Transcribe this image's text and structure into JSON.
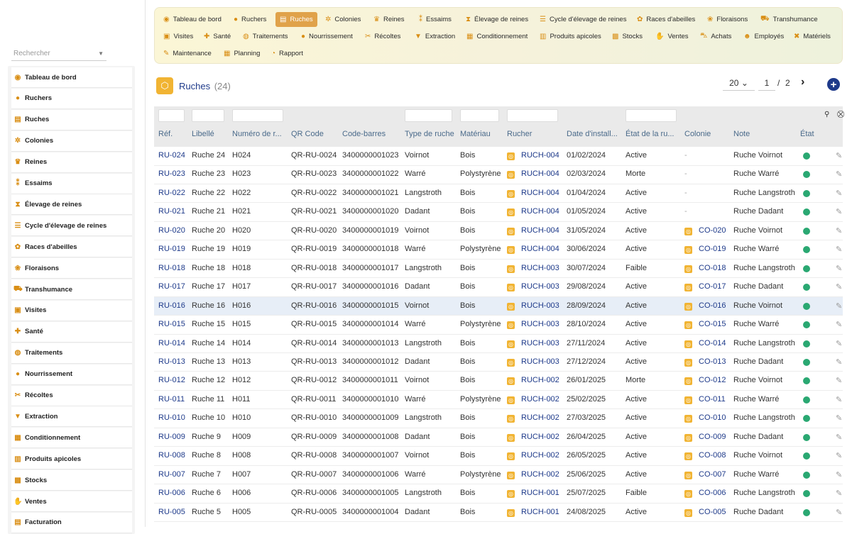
{
  "sidebar": {
    "search_placeholder": "Rechercher",
    "items": [
      {
        "label": "Tableau de bord",
        "icon": "dashboard-icon"
      },
      {
        "label": "Ruchers",
        "icon": "map-pin-icon"
      },
      {
        "label": "Ruches",
        "icon": "hive-icon"
      },
      {
        "label": "Colonies",
        "icon": "bee-icon"
      },
      {
        "label": "Reines",
        "icon": "crown-icon"
      },
      {
        "label": "Essaims",
        "icon": "swarm-icon"
      },
      {
        "label": "Élevage de reines",
        "icon": "hourglass-icon"
      },
      {
        "label": "Cycle d'élevage de reines",
        "icon": "cycle-icon"
      },
      {
        "label": "Races d'abeilles",
        "icon": "race-icon"
      },
      {
        "label": "Floraisons",
        "icon": "flower-icon"
      },
      {
        "label": "Transhumance",
        "icon": "truck-icon"
      },
      {
        "label": "Visites",
        "icon": "clipboard-icon"
      },
      {
        "label": "Santé",
        "icon": "health-icon"
      },
      {
        "label": "Traitements",
        "icon": "pills-icon"
      },
      {
        "label": "Nourrissement",
        "icon": "drop-icon"
      },
      {
        "label": "Récoltes",
        "icon": "harvest-icon"
      },
      {
        "label": "Extraction",
        "icon": "funnel-icon"
      },
      {
        "label": "Conditionnement",
        "icon": "box-icon"
      },
      {
        "label": "Produits apicoles",
        "icon": "product-icon"
      },
      {
        "label": "Stocks",
        "icon": "stock-icon"
      },
      {
        "label": "Ventes",
        "icon": "sales-icon"
      },
      {
        "label": "Facturation",
        "icon": "invoice-icon"
      }
    ]
  },
  "topnav": {
    "items": [
      {
        "label": "Tableau de bord",
        "glyph": "◉",
        "active": false
      },
      {
        "label": "Ruchers",
        "glyph": "●",
        "active": false
      },
      {
        "label": "Ruches",
        "glyph": "▤",
        "active": true
      },
      {
        "label": "Colonies",
        "glyph": "✲",
        "active": false
      },
      {
        "label": "Reines",
        "glyph": "♛",
        "active": false
      },
      {
        "label": "Essaims",
        "glyph": "⁑",
        "active": false
      },
      {
        "label": "Élevage de reines",
        "glyph": "⧗",
        "active": false
      },
      {
        "label": "Cycle d'élevage de reines",
        "glyph": "☰",
        "active": false
      },
      {
        "label": "Races d'abeilles",
        "glyph": "✿",
        "active": false
      },
      {
        "label": "Floraisons",
        "glyph": "❀",
        "active": false
      },
      {
        "label": "Transhumance",
        "glyph": "⛟",
        "active": false
      },
      {
        "label": "Visites",
        "glyph": "▣",
        "active": false
      },
      {
        "label": "Santé",
        "glyph": "✚",
        "active": false
      },
      {
        "label": "Traitements",
        "glyph": "◍",
        "active": false
      },
      {
        "label": "Nourrissement",
        "glyph": "●",
        "active": false
      },
      {
        "label": "Récoltes",
        "glyph": "✂",
        "active": false
      },
      {
        "label": "Extraction",
        "glyph": "▼",
        "active": false
      },
      {
        "label": "Conditionnement",
        "glyph": "▦",
        "active": false
      },
      {
        "label": "Produits apicoles",
        "glyph": "▥",
        "active": false
      },
      {
        "label": "Stocks",
        "glyph": "▩",
        "active": false
      },
      {
        "label": "Ventes",
        "glyph": "✋",
        "active": false
      },
      {
        "label": "Achats",
        "glyph": "⛍",
        "active": false
      },
      {
        "label": "Employés",
        "glyph": "☻",
        "active": false
      },
      {
        "label": "Matériels",
        "glyph": "✖",
        "active": false
      },
      {
        "label": "Maintenance",
        "glyph": "✎",
        "active": false
      },
      {
        "label": "Planning",
        "glyph": "▦",
        "active": false
      },
      {
        "label": "Rapport",
        "glyph": "◔",
        "active": false
      }
    ]
  },
  "header": {
    "title": "Ruches",
    "count": "(24)",
    "page_size": "20",
    "page_current": "1",
    "page_sep": "/",
    "page_total": "2"
  },
  "table": {
    "columns": [
      "Réf.",
      "Libellé",
      "Numéro de r...",
      "QR Code",
      "Code-barres",
      "Type de ruche",
      "Matériau",
      "Rucher",
      "Date d'install...",
      "État de la ru...",
      "Colonie",
      "Note",
      "État"
    ],
    "rows": [
      {
        "ref": "RU-024",
        "libelle": "Ruche 24",
        "numero": "H024",
        "qr": "QR-RU-0024",
        "barcode": "3400000001023",
        "type": "Voirnot",
        "materiau": "Bois",
        "rucher": "RUCH-004",
        "date": "01/02/2024",
        "etat": "Active",
        "colonie": "-",
        "note": "Ruche Voirnot"
      },
      {
        "ref": "RU-023",
        "libelle": "Ruche 23",
        "numero": "H023",
        "qr": "QR-RU-0023",
        "barcode": "3400000001022",
        "type": "Warré",
        "materiau": "Polystyrène",
        "rucher": "RUCH-004",
        "date": "02/03/2024",
        "etat": "Morte",
        "colonie": "-",
        "note": "Ruche Warré"
      },
      {
        "ref": "RU-022",
        "libelle": "Ruche 22",
        "numero": "H022",
        "qr": "QR-RU-0022",
        "barcode": "3400000001021",
        "type": "Langstroth",
        "materiau": "Bois",
        "rucher": "RUCH-004",
        "date": "01/04/2024",
        "etat": "Active",
        "colonie": "-",
        "note": "Ruche Langstroth"
      },
      {
        "ref": "RU-021",
        "libelle": "Ruche 21",
        "numero": "H021",
        "qr": "QR-RU-0021",
        "barcode": "3400000001020",
        "type": "Dadant",
        "materiau": "Bois",
        "rucher": "RUCH-004",
        "date": "01/05/2024",
        "etat": "Active",
        "colonie": "-",
        "note": "Ruche Dadant"
      },
      {
        "ref": "RU-020",
        "libelle": "Ruche 20",
        "numero": "H020",
        "qr": "QR-RU-0020",
        "barcode": "3400000001019",
        "type": "Voirnot",
        "materiau": "Bois",
        "rucher": "RUCH-004",
        "date": "31/05/2024",
        "etat": "Active",
        "colonie": "CO-020",
        "note": "Ruche Voirnot"
      },
      {
        "ref": "RU-019",
        "libelle": "Ruche 19",
        "numero": "H019",
        "qr": "QR-RU-0019",
        "barcode": "3400000001018",
        "type": "Warré",
        "materiau": "Polystyrène",
        "rucher": "RUCH-004",
        "date": "30/06/2024",
        "etat": "Active",
        "colonie": "CO-019",
        "note": "Ruche Warré"
      },
      {
        "ref": "RU-018",
        "libelle": "Ruche 18",
        "numero": "H018",
        "qr": "QR-RU-0018",
        "barcode": "3400000001017",
        "type": "Langstroth",
        "materiau": "Bois",
        "rucher": "RUCH-003",
        "date": "30/07/2024",
        "etat": "Faible",
        "colonie": "CO-018",
        "note": "Ruche Langstroth"
      },
      {
        "ref": "RU-017",
        "libelle": "Ruche 17",
        "numero": "H017",
        "qr": "QR-RU-0017",
        "barcode": "3400000001016",
        "type": "Dadant",
        "materiau": "Bois",
        "rucher": "RUCH-003",
        "date": "29/08/2024",
        "etat": "Active",
        "colonie": "CO-017",
        "note": "Ruche Dadant"
      },
      {
        "ref": "RU-016",
        "libelle": "Ruche 16",
        "numero": "H016",
        "qr": "QR-RU-0016",
        "barcode": "3400000001015",
        "type": "Voirnot",
        "materiau": "Bois",
        "rucher": "RUCH-003",
        "date": "28/09/2024",
        "etat": "Active",
        "colonie": "CO-016",
        "note": "Ruche Voirnot",
        "hl": true
      },
      {
        "ref": "RU-015",
        "libelle": "Ruche 15",
        "numero": "H015",
        "qr": "QR-RU-0015",
        "barcode": "3400000001014",
        "type": "Warré",
        "materiau": "Polystyrène",
        "rucher": "RUCH-003",
        "date": "28/10/2024",
        "etat": "Active",
        "colonie": "CO-015",
        "note": "Ruche Warré"
      },
      {
        "ref": "RU-014",
        "libelle": "Ruche 14",
        "numero": "H014",
        "qr": "QR-RU-0014",
        "barcode": "3400000001013",
        "type": "Langstroth",
        "materiau": "Bois",
        "rucher": "RUCH-003",
        "date": "27/11/2024",
        "etat": "Active",
        "colonie": "CO-014",
        "note": "Ruche Langstroth"
      },
      {
        "ref": "RU-013",
        "libelle": "Ruche 13",
        "numero": "H013",
        "qr": "QR-RU-0013",
        "barcode": "3400000001012",
        "type": "Dadant",
        "materiau": "Bois",
        "rucher": "RUCH-003",
        "date": "27/12/2024",
        "etat": "Active",
        "colonie": "CO-013",
        "note": "Ruche Dadant"
      },
      {
        "ref": "RU-012",
        "libelle": "Ruche 12",
        "numero": "H012",
        "qr": "QR-RU-0012",
        "barcode": "3400000001011",
        "type": "Voirnot",
        "materiau": "Bois",
        "rucher": "RUCH-002",
        "date": "26/01/2025",
        "etat": "Morte",
        "colonie": "CO-012",
        "note": "Ruche Voirnot"
      },
      {
        "ref": "RU-011",
        "libelle": "Ruche 11",
        "numero": "H011",
        "qr": "QR-RU-0011",
        "barcode": "3400000001010",
        "type": "Warré",
        "materiau": "Polystyrène",
        "rucher": "RUCH-002",
        "date": "25/02/2025",
        "etat": "Active",
        "colonie": "CO-011",
        "note": "Ruche Warré"
      },
      {
        "ref": "RU-010",
        "libelle": "Ruche 10",
        "numero": "H010",
        "qr": "QR-RU-0010",
        "barcode": "3400000001009",
        "type": "Langstroth",
        "materiau": "Bois",
        "rucher": "RUCH-002",
        "date": "27/03/2025",
        "etat": "Active",
        "colonie": "CO-010",
        "note": "Ruche Langstroth"
      },
      {
        "ref": "RU-009",
        "libelle": "Ruche 9",
        "numero": "H009",
        "qr": "QR-RU-0009",
        "barcode": "3400000001008",
        "type": "Dadant",
        "materiau": "Bois",
        "rucher": "RUCH-002",
        "date": "26/04/2025",
        "etat": "Active",
        "colonie": "CO-009",
        "note": "Ruche Dadant"
      },
      {
        "ref": "RU-008",
        "libelle": "Ruche 8",
        "numero": "H008",
        "qr": "QR-RU-0008",
        "barcode": "3400000001007",
        "type": "Voirnot",
        "materiau": "Bois",
        "rucher": "RUCH-002",
        "date": "26/05/2025",
        "etat": "Active",
        "colonie": "CO-008",
        "note": "Ruche Voirnot"
      },
      {
        "ref": "RU-007",
        "libelle": "Ruche 7",
        "numero": "H007",
        "qr": "QR-RU-0007",
        "barcode": "3400000001006",
        "type": "Warré",
        "materiau": "Polystyrène",
        "rucher": "RUCH-002",
        "date": "25/06/2025",
        "etat": "Active",
        "colonie": "CO-007",
        "note": "Ruche Warré"
      },
      {
        "ref": "RU-006",
        "libelle": "Ruche 6",
        "numero": "H006",
        "qr": "QR-RU-0006",
        "barcode": "3400000001005",
        "type": "Langstroth",
        "materiau": "Bois",
        "rucher": "RUCH-001",
        "date": "25/07/2025",
        "etat": "Faible",
        "colonie": "CO-006",
        "note": "Ruche Langstroth"
      },
      {
        "ref": "RU-005",
        "libelle": "Ruche 5",
        "numero": "H005",
        "qr": "QR-RU-0005",
        "barcode": "3400000001004",
        "type": "Dadant",
        "materiau": "Bois",
        "rucher": "RUCH-001",
        "date": "24/08/2025",
        "etat": "Active",
        "colonie": "CO-005",
        "note": "Ruche Dadant"
      }
    ]
  },
  "colors": {
    "accent": "#e0a24a",
    "link": "#1e3a8a",
    "status_ok": "#2aa872",
    "hive_badge": "#f1b433"
  }
}
